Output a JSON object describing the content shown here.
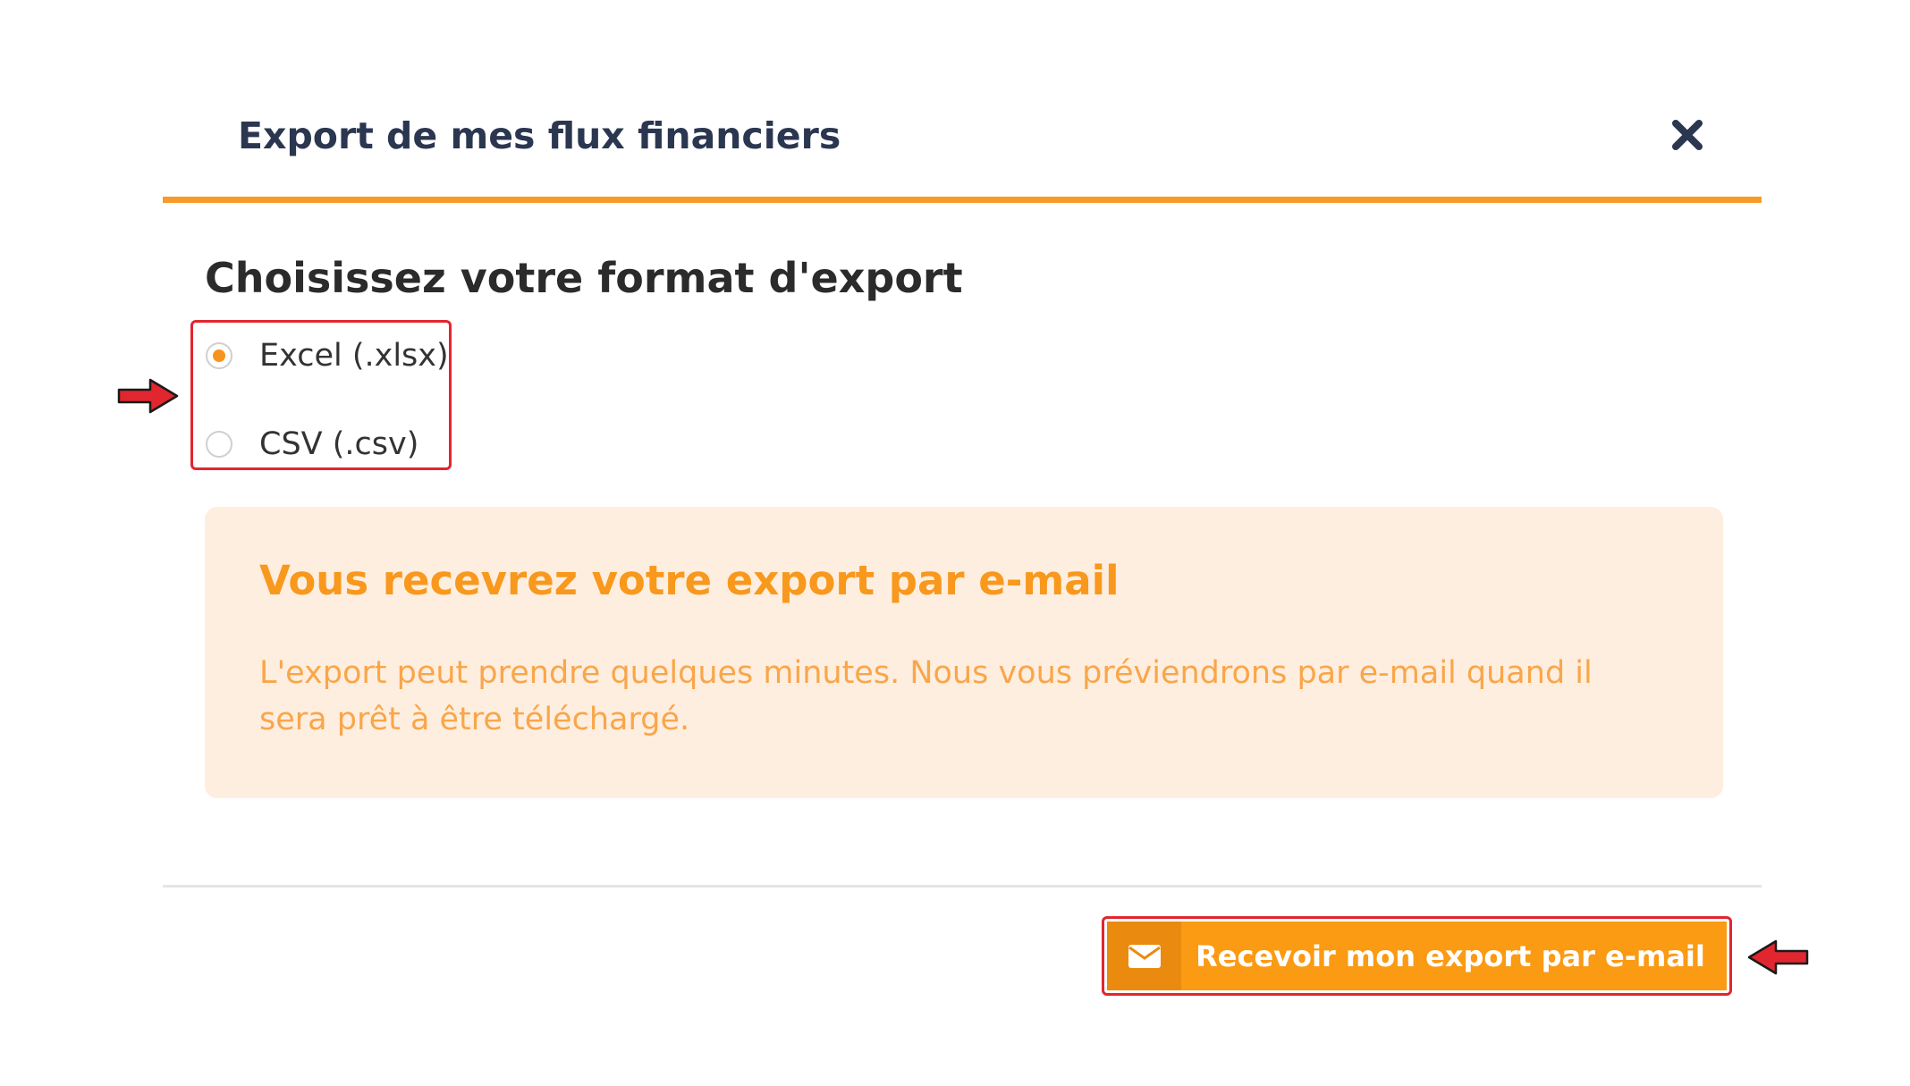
{
  "modal": {
    "title": "Export de mes flux financiers",
    "close_icon": "close-icon"
  },
  "format": {
    "heading": "Choisissez votre format d'export",
    "options": [
      {
        "label": "Excel (.xlsx)",
        "selected": true
      },
      {
        "label": "CSV (.csv)",
        "selected": false
      }
    ]
  },
  "info": {
    "title": "Vous recevrez votre export par e-mail",
    "text": "L'export peut prendre quelques minutes. Nous vous préviendrons par e-mail quand il sera prêt à être téléchargé."
  },
  "footer": {
    "export_button_label": "Recevoir mon export par e-mail",
    "export_button_icon": "envelope-icon"
  },
  "colors": {
    "accent": "#f89a2a",
    "button": "#fb9a13",
    "button_icon_bg": "#ea8b10",
    "info_bg": "#feeedf",
    "title_text": "#2b3750",
    "highlight_annotation": "#e2262f"
  }
}
